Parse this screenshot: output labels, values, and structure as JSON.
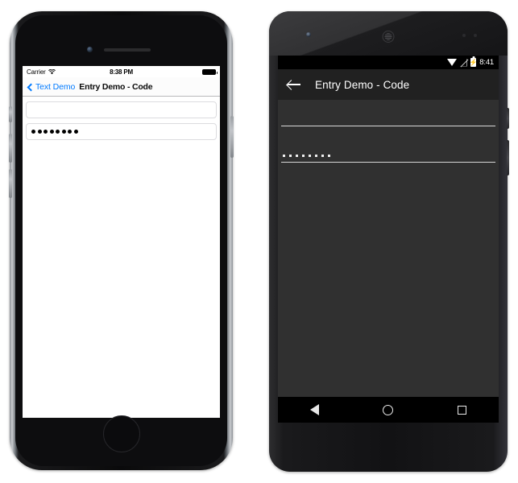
{
  "ios": {
    "status_bar": {
      "carrier": "Carrier",
      "wifi_icon": "wifi-icon",
      "time": "8:38 PM",
      "battery_icon": "battery-full-icon"
    },
    "nav_bar": {
      "back_chevron_icon": "chevron-left-icon",
      "back_label": "Text Demo",
      "title": "Entry Demo - Code",
      "tint_color": "#007aff"
    },
    "content": {
      "entry_text": {
        "value": "",
        "placeholder": ""
      },
      "entry_password": {
        "masked": true,
        "dot_count": 8,
        "value": "••••••••"
      }
    },
    "hardware": {
      "camera_icon": "front-camera-icon",
      "speaker_icon": "earpiece-speaker-icon",
      "home_button_icon": "home-button-icon"
    }
  },
  "android": {
    "status_bar": {
      "wifi_icon": "wifi-icon",
      "signal_icon": "no-signal-icon",
      "battery_icon": "battery-charging-icon",
      "battery_bolt": "⚡",
      "time": "8:41"
    },
    "app_bar": {
      "back_icon": "arrow-back-icon",
      "title": "Entry Demo - Code",
      "background_color": "#212121"
    },
    "content": {
      "background_color": "#303030",
      "entry_text": {
        "value": "",
        "placeholder": ""
      },
      "entry_password": {
        "masked": true,
        "dot_count": 8,
        "value": "••••••••"
      }
    },
    "nav_bar": {
      "back_icon": "nav-back-icon",
      "home_icon": "nav-home-icon",
      "recents_icon": "nav-recents-icon"
    },
    "hardware": {
      "camera_icon": "front-camera-icon",
      "speaker_icon": "earpiece-speaker-icon"
    }
  }
}
